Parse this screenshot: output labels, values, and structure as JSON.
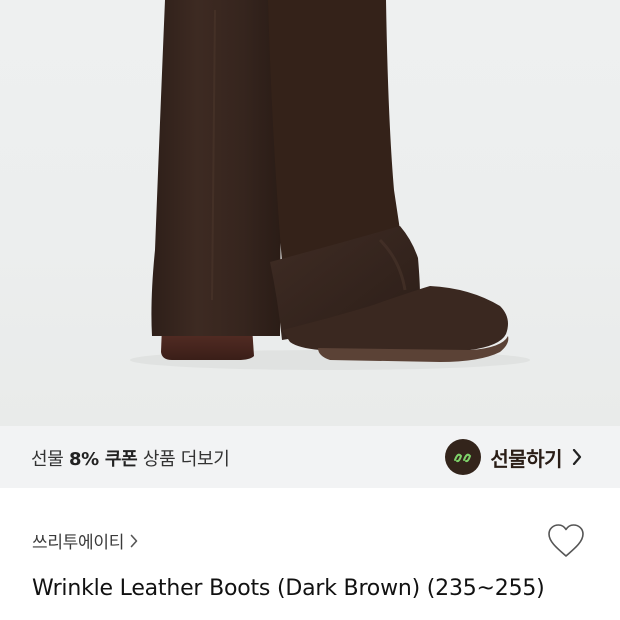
{
  "product_image": {
    "alt": "Wrinkle Leather Boots (Dark Brown)",
    "colors": {
      "background": "#eceeee",
      "boot": "#3a2820",
      "heel": "#4a2a22"
    }
  },
  "gift_banner": {
    "prefix": "선물",
    "discount": "8% 쿠폰",
    "suffix": "상품 더보기",
    "button_label": "선물하기",
    "logo_icon": "gift-logo-icon",
    "chevron_icon": "chevron-right-icon",
    "colors": {
      "background": "#f2f3f4",
      "logo": "#33241b",
      "text": "#2a1d16"
    }
  },
  "brand": {
    "name": "쓰리투에이티",
    "chevron_icon": "chevron-right-icon"
  },
  "like": {
    "icon": "heart-outline-icon"
  },
  "product": {
    "title": "Wrinkle Leather Boots (Dark Brown) (235~255)"
  }
}
